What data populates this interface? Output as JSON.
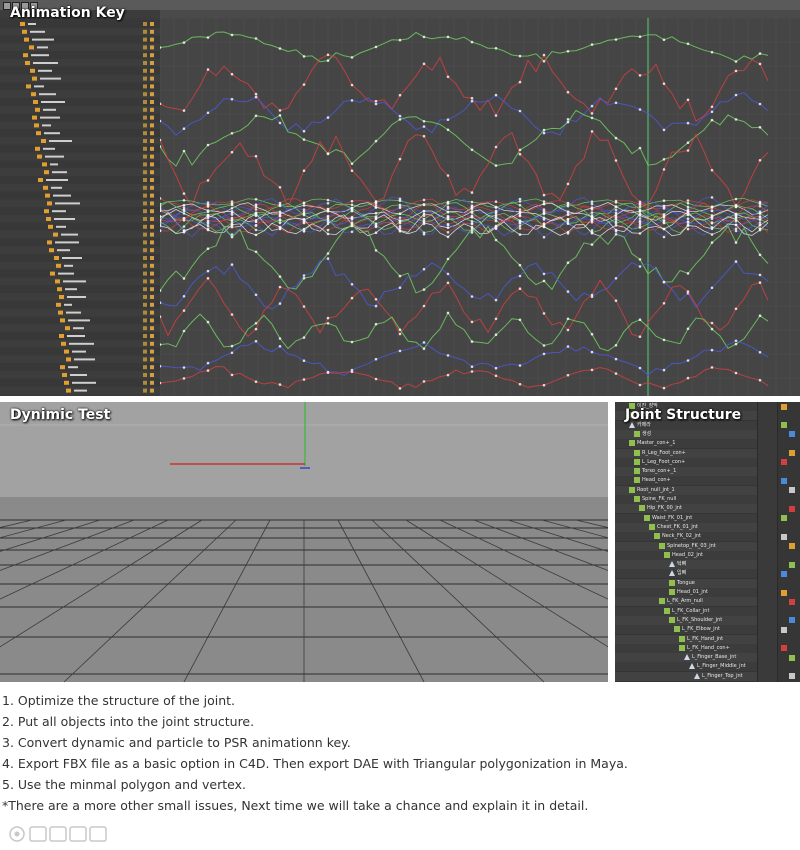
{
  "panels": {
    "animation_key": {
      "title": "Animation Key"
    },
    "dynamic_test": {
      "title": "Dynimic Test"
    },
    "joint_structure": {
      "title": "Joint Structure"
    }
  },
  "joint_rows": [
    "이진_장막",
    "지크프",
    "카메라",
    "생성",
    "Master_con+_1",
    "R_Leg_Foot_con+",
    "L_Leg_Foot_con+",
    "Torso_con+_1",
    "Head_con+",
    "Root_null_jnt_1",
    "Spine_FK_null",
    "Hip_FK_00_jnt",
    "Waist_FK_01_jnt",
    "Chest_FK_01_jnt",
    "Neck_FK_02_jnt",
    "Spinetop_FK_03_jnt",
    "Head_02_jnt",
    "턱뼈",
    "입뼈",
    "Tongue",
    "Head_01_jnt",
    "L_FK_Arm_null",
    "L_FK_Collar_jnt",
    "L_FK_Shoulder_jnt",
    "L_FK_Elbow_jnt",
    "L_FK_Hand_jnt",
    "L_FK_Hand_con+",
    "L_Finger_Base_jnt",
    "L_Finger_Middle_jnt",
    "L_Finger_Top_jnt"
  ],
  "notes": [
    "1. Optimize the structure of the joint.",
    "2. Put all objects into the joint structure.",
    "3. Convert dynamic and particle to PSR animationn key.",
    "4. Export FBX file as a basic option in C4D. Then export DAE with Triangular polygonization in Maya.",
    "5. Use the minmal polygon and vertex.",
    "*There are a more other small issues, Next time we will take a chance and explain it in detail."
  ],
  "watermark": {
    "logo": "watermark-logo"
  },
  "colors": {
    "curve_green": "#6fcf5f",
    "curve_red": "#d04040",
    "curve_blue": "#4a58d8",
    "curve_white": "#e8e8f0",
    "folder_orange": "#e0a030",
    "axis_green": "#20c020",
    "axis_red": "#d02020",
    "axis_blue": "#2030d0"
  }
}
